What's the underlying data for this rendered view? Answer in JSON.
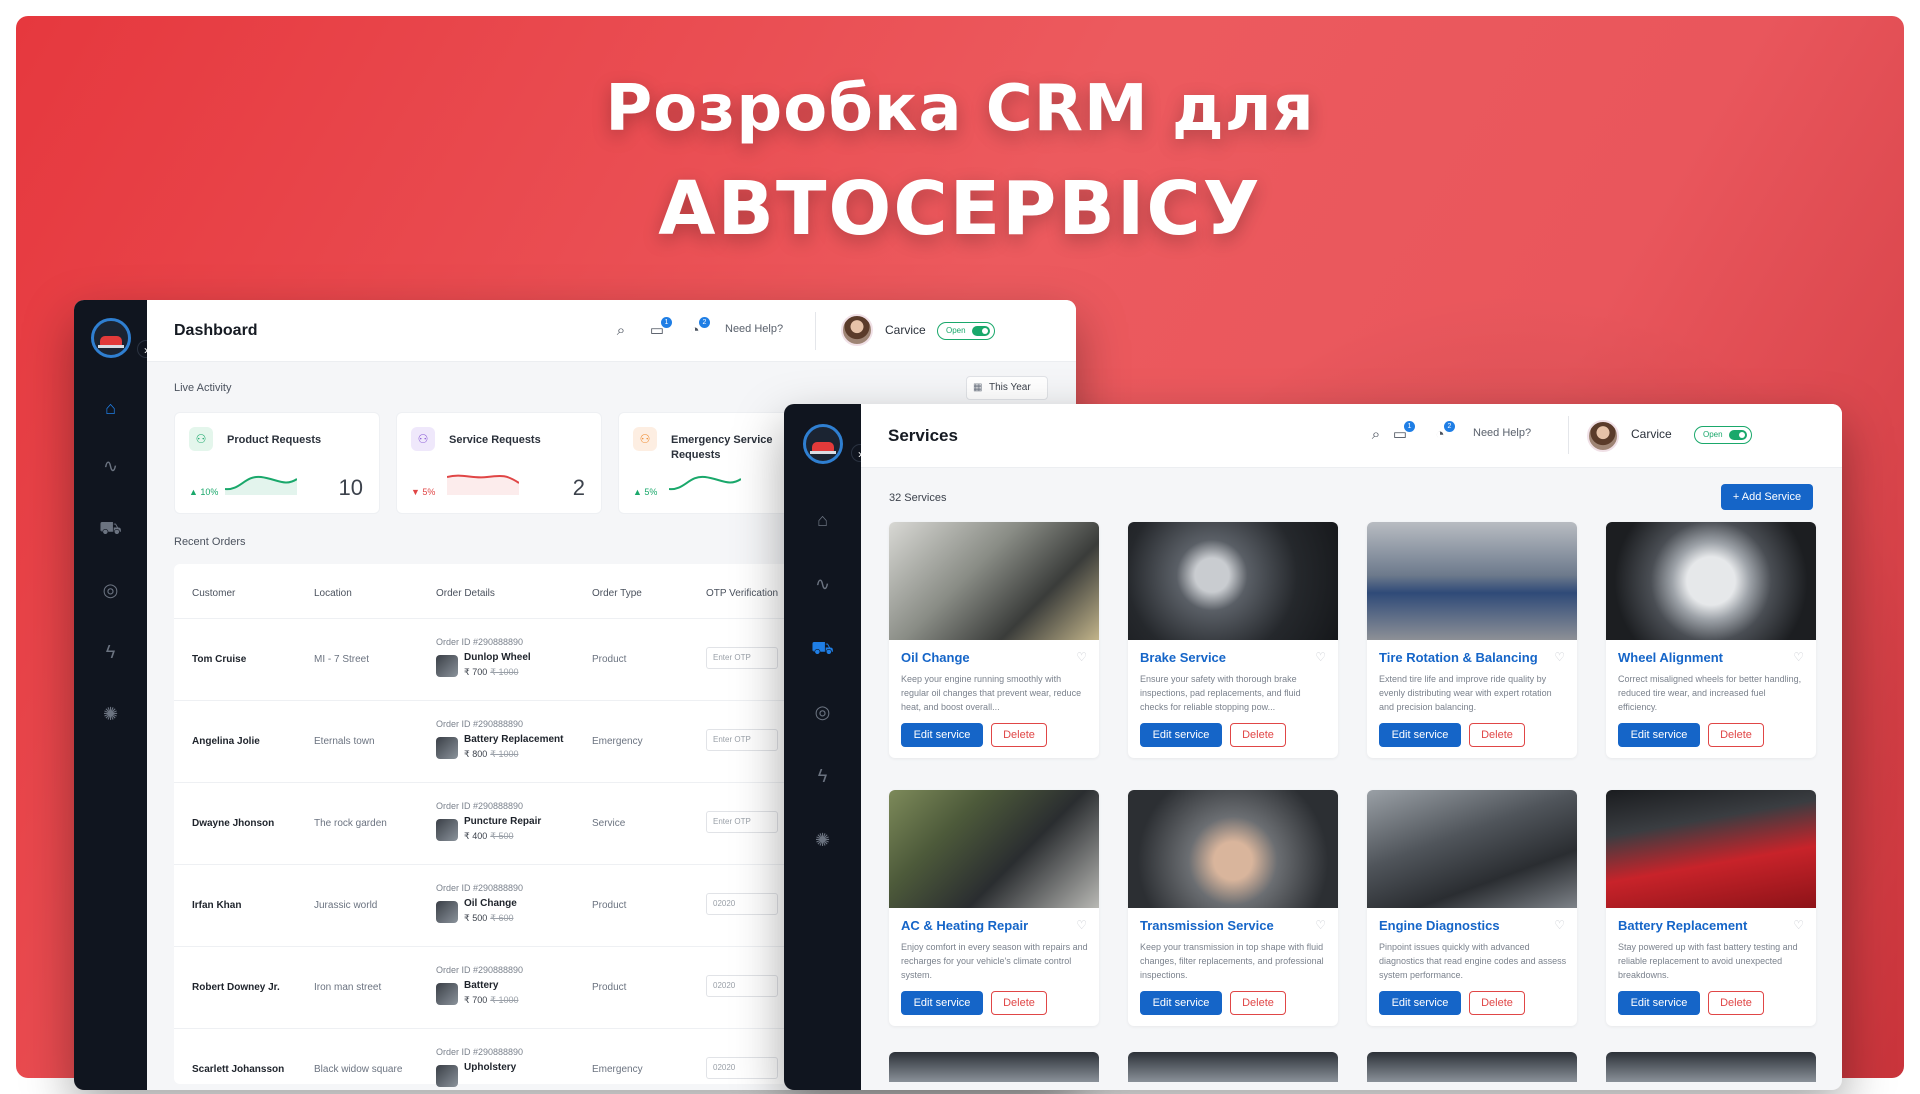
{
  "banner": {
    "title_line1": "Розробка CRM для",
    "title_line2": "АВТОСЕРВІСУ"
  },
  "colors": {
    "banner": "#e6383e",
    "sidebar": "#10151f",
    "accent": "#1565c8",
    "danger": "#e04646",
    "success": "#1aa86b"
  },
  "dashboard": {
    "title": "Dashboard",
    "help": "Need Help?",
    "user": "Carvice",
    "status": "Open",
    "msg_badge": "1",
    "notif_badge": "2",
    "live_activity": "Live Activity",
    "range": "This Year",
    "cards": [
      {
        "label": "Product Requests",
        "pct": "▲ 10%",
        "value": "10",
        "trend": "up"
      },
      {
        "label": "Service Requests",
        "pct": "▼ 5%",
        "value": "2",
        "trend": "down"
      },
      {
        "label": "Emergency Service Requests",
        "pct": "▲ 5%",
        "value": "",
        "trend": "up"
      }
    ],
    "recent_orders": "Recent Orders",
    "columns": [
      "Customer",
      "Location",
      "Order Details",
      "Order Type",
      "OTP Verification"
    ],
    "orders": [
      {
        "customer": "Tom Cruise",
        "location": "MI - 7 Street",
        "order_id": "Order ID #290888890",
        "product": "Dunlop Wheel",
        "price": "₹ 700",
        "old_price": "₹ 1000",
        "type": "Product",
        "otp": "Enter OTP"
      },
      {
        "customer": "Angelina Jolie",
        "location": "Eternals town",
        "order_id": "Order ID #290888890",
        "product": "Battery Replacement",
        "price": "₹ 800",
        "old_price": "₹ 1000",
        "type": "Emergency",
        "otp": "Enter OTP"
      },
      {
        "customer": "Dwayne Jhonson",
        "location": "The rock garden",
        "order_id": "Order ID #290888890",
        "product": "Puncture Repair",
        "price": "₹ 400",
        "old_price": "₹ 500",
        "type": "Service",
        "otp": "Enter OTP"
      },
      {
        "customer": "Irfan Khan",
        "location": "Jurassic world",
        "order_id": "Order ID #290888890",
        "product": "Oil Change",
        "price": "₹ 500",
        "old_price": "₹ 600",
        "type": "Product",
        "otp": "02020"
      },
      {
        "customer": "Robert Downey Jr.",
        "location": "Iron man street",
        "order_id": "Order ID #290888890",
        "product": "Battery",
        "price": "₹ 700",
        "old_price": "₹ 1000",
        "type": "Product",
        "otp": "02020"
      },
      {
        "customer": "Scarlett Johansson",
        "location": "Black widow square",
        "order_id": "Order ID #290888890",
        "product": "Upholstery",
        "price": "",
        "old_price": "",
        "type": "Emergency",
        "otp": "02020"
      }
    ]
  },
  "services": {
    "title": "Services",
    "help": "Need Help?",
    "user": "Carvice",
    "status": "Open",
    "msg_badge": "1",
    "notif_badge": "2",
    "count": "32 Services",
    "add_label": "+ Add Service",
    "edit_label": "Edit service",
    "delete_label": "Delete",
    "items": [
      {
        "name": "Oil Change",
        "desc": "Keep your engine running smoothly with regular oil changes that prevent wear, reduce heat, and boost overall...",
        "image": "engine-oil-photo"
      },
      {
        "name": "Brake Service",
        "desc": "Ensure your safety with thorough brake inspections, pad replacements, and fluid checks for reliable stopping pow...",
        "image": "engine-bay-photo"
      },
      {
        "name": "Tire Rotation & Balancing",
        "desc": "Extend tire life and improve ride quality by evenly distributing wear with expert rotation and precision balancing.",
        "image": "garage-lifts-photo"
      },
      {
        "name": "Wheel Alignment",
        "desc": "Correct misaligned wheels for better handling, reduced tire wear, and increased fuel efficiency.",
        "image": "wheel-photo"
      },
      {
        "name": "AC & Heating Repair",
        "desc": "Enjoy comfort in every season with repairs and recharges for your vehicle's climate control system.",
        "image": "engine-repair-photo"
      },
      {
        "name": "Transmission Service",
        "desc": "Keep your transmission in top shape with fluid changes, filter replacements, and professional inspections.",
        "image": "mechanic-photo"
      },
      {
        "name": "Engine Diagnostics",
        "desc": "Pinpoint issues quickly with advanced diagnostics that read engine codes and assess system performance.",
        "image": "diagnostics-photo"
      },
      {
        "name": "Battery Replacement",
        "desc": "Stay powered up with fast battery testing and reliable replacement to avoid unexpected breakdowns.",
        "image": "red-car-photo"
      }
    ]
  }
}
